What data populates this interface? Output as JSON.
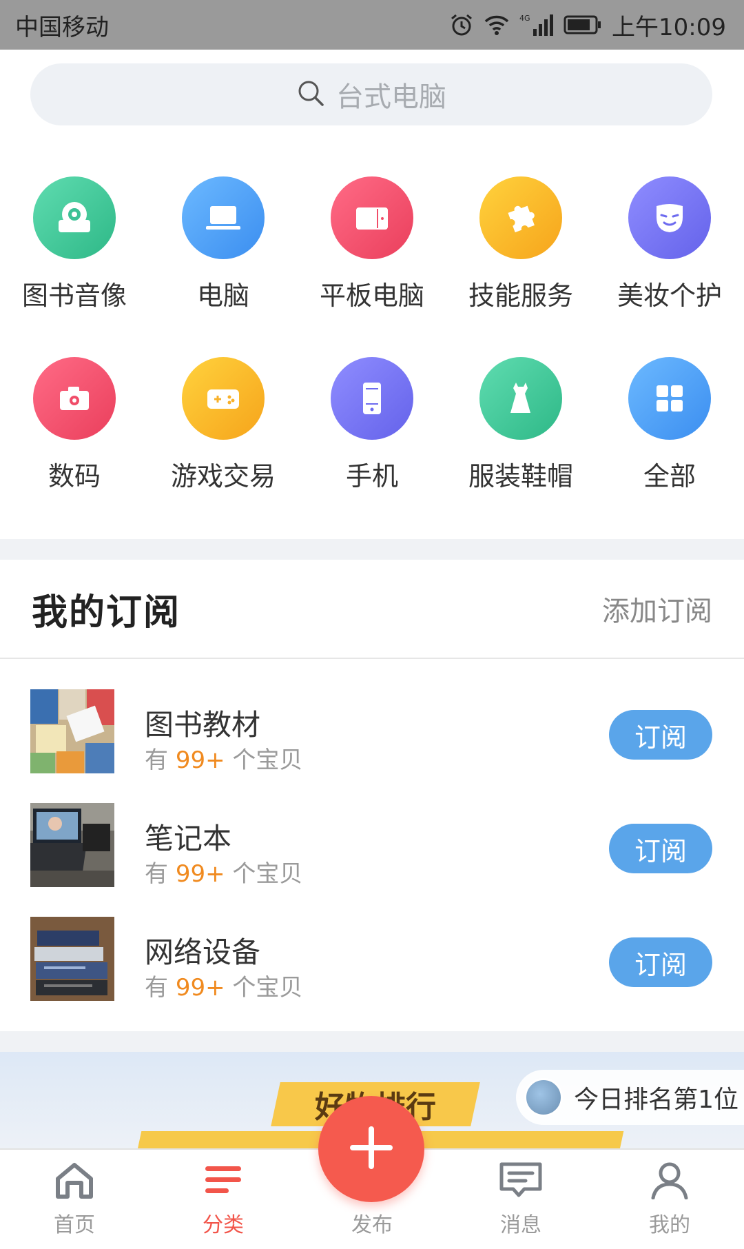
{
  "status_bar": {
    "carrier": "中国移动",
    "network": "4G",
    "time": "上午10:09"
  },
  "search": {
    "placeholder": "台式电脑"
  },
  "categories": [
    {
      "label": "图书音像",
      "icon": "camera-lens-icon",
      "color": "#43c89b"
    },
    {
      "label": "电脑",
      "icon": "laptop-icon",
      "color": "#4a9ff5"
    },
    {
      "label": "平板电脑",
      "icon": "tablet-icon",
      "color": "#f2546f"
    },
    {
      "label": "技能服务",
      "icon": "puzzle-icon",
      "color": "#fbb62a"
    },
    {
      "label": "美妆个护",
      "icon": "mask-icon",
      "color": "#7a78f2"
    },
    {
      "label": "数码",
      "icon": "camera-icon",
      "color": "#f2546f"
    },
    {
      "label": "游戏交易",
      "icon": "gamepad-icon",
      "color": "#fbb62a"
    },
    {
      "label": "手机",
      "icon": "phone-icon",
      "color": "#7a78f2"
    },
    {
      "label": "服装鞋帽",
      "icon": "dress-icon",
      "color": "#43c89b"
    },
    {
      "label": "全部",
      "icon": "grid-icon",
      "color": "#4a9ff5"
    }
  ],
  "subscriptions": {
    "title": "我的订阅",
    "add_label": "添加订阅",
    "items": [
      {
        "name": "图书教材",
        "count_prefix": "有",
        "count": "99+",
        "count_suffix": "个宝贝",
        "button": "订阅",
        "thumb": "books-thumbnail"
      },
      {
        "name": "笔记本",
        "count_prefix": "有",
        "count": "99+",
        "count_suffix": "个宝贝",
        "button": "订阅",
        "thumb": "laptop-thumbnail"
      },
      {
        "name": "网络设备",
        "count_prefix": "有",
        "count": "99+",
        "count_suffix": "个宝贝",
        "button": "订阅",
        "thumb": "network-switch-thumbnail"
      }
    ]
  },
  "banner": {
    "title": "好物排行",
    "rank_text": "今日排名第1位"
  },
  "bottom_nav": {
    "items": [
      {
        "label": "首页",
        "icon": "home-icon"
      },
      {
        "label": "分类",
        "icon": "category-icon",
        "active": true
      },
      {
        "label": "发布",
        "icon": "plus-icon"
      },
      {
        "label": "消息",
        "icon": "message-icon"
      },
      {
        "label": "我的",
        "icon": "user-icon"
      }
    ]
  },
  "colors": {
    "accent_red": "#f55a4e",
    "subscribe_blue": "#5aa5ea",
    "count_orange": "#f08a1f"
  }
}
